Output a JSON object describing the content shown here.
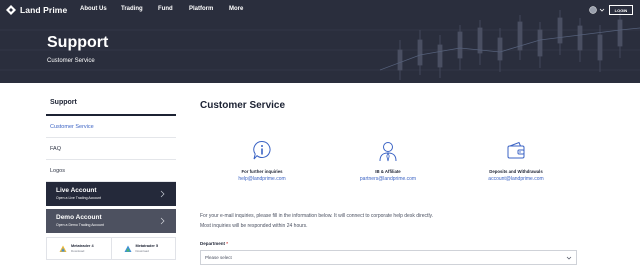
{
  "nav": {
    "brand": "Land Prime",
    "items": [
      "About Us",
      "Trading",
      "Fund",
      "Platform",
      "More"
    ],
    "login": "LOGIN"
  },
  "hero": {
    "title": "Support",
    "subtitle": "Customer Service"
  },
  "sidebar": {
    "heading": "Support",
    "items": [
      {
        "label": "Customer Service",
        "active": true
      },
      {
        "label": "FAQ",
        "active": false
      },
      {
        "label": "Logos",
        "active": false
      }
    ],
    "live": {
      "title": "Live Account",
      "subtitle": "Open a Live Trading Account"
    },
    "demo": {
      "title": "Demo Account",
      "subtitle": "Open a Demo Trading Account"
    },
    "metatrader": [
      {
        "name": "Metatrader 4",
        "action": "Download"
      },
      {
        "name": "Metatrader 5",
        "action": "Download"
      }
    ]
  },
  "main": {
    "title": "Customer Service",
    "contacts": [
      {
        "icon": "info-chat-icon",
        "label": "For further inquiries",
        "email": "help@landprime.com"
      },
      {
        "icon": "ib-affiliate-person-icon",
        "label": "IB & Affiliate",
        "email": "partners@landprime.com"
      },
      {
        "icon": "wallet-icon",
        "label": "Deposits and Withdrawals",
        "email": "account@landprime.com"
      }
    ],
    "intro_line1": "For your e-mail inquiries, please fill in the information below. It will connect to corporate help desk directly.",
    "intro_line2": "Most inquiries will be responded within 24 hours.",
    "department_label": "Department",
    "department_required": "*",
    "department_value": "Please select"
  },
  "colors": {
    "hero_bg": "#2a2e3d",
    "accent_blue": "#3b63c4",
    "dark_panel": "#24293a",
    "grey_panel": "#4d5160",
    "required": "#d23a3a"
  }
}
